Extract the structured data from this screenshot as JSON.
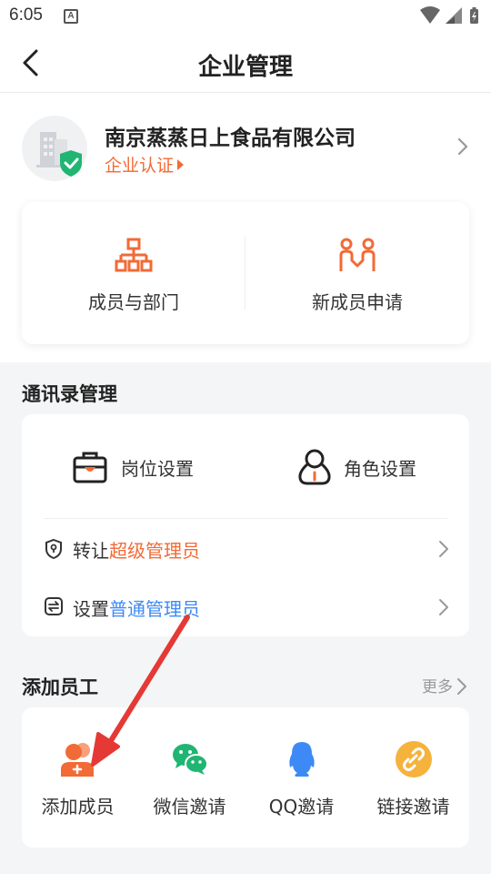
{
  "status_bar": {
    "time": "6:05",
    "notification_badge": "A"
  },
  "header": {
    "title": "企业管理"
  },
  "company": {
    "name": "南京蒸蒸日上食品有限公司",
    "cert_label": "企业认证"
  },
  "quick_actions": [
    {
      "label": "成员与部门",
      "icon": "org-chart-icon"
    },
    {
      "label": "新成员申请",
      "icon": "member-apply-icon"
    }
  ],
  "contacts_section": {
    "title": "通讯录管理",
    "cells": [
      {
        "label": "岗位设置",
        "icon": "briefcase-icon"
      },
      {
        "label": "角色设置",
        "icon": "user-role-icon"
      }
    ],
    "rows": [
      {
        "prefix": "转让",
        "highlight": "超级管理员",
        "highlight_color": "#f26a35",
        "icon": "shield-icon"
      },
      {
        "prefix": "设置",
        "highlight": "普通管理员",
        "highlight_color": "#3d8af7",
        "icon": "switch-icon"
      }
    ]
  },
  "add_section": {
    "title": "添加员工",
    "more_label": "更多",
    "actions": [
      {
        "label": "添加成员",
        "icon": "add-member-icon"
      },
      {
        "label": "微信邀请",
        "icon": "wechat-icon"
      },
      {
        "label": "QQ邀请",
        "icon": "qq-icon"
      },
      {
        "label": "链接邀请",
        "icon": "link-icon"
      }
    ]
  },
  "colors": {
    "accent": "#f26a35",
    "blue": "#3d8af7",
    "green": "#21b573",
    "annotation_arrow": "#e53935"
  }
}
